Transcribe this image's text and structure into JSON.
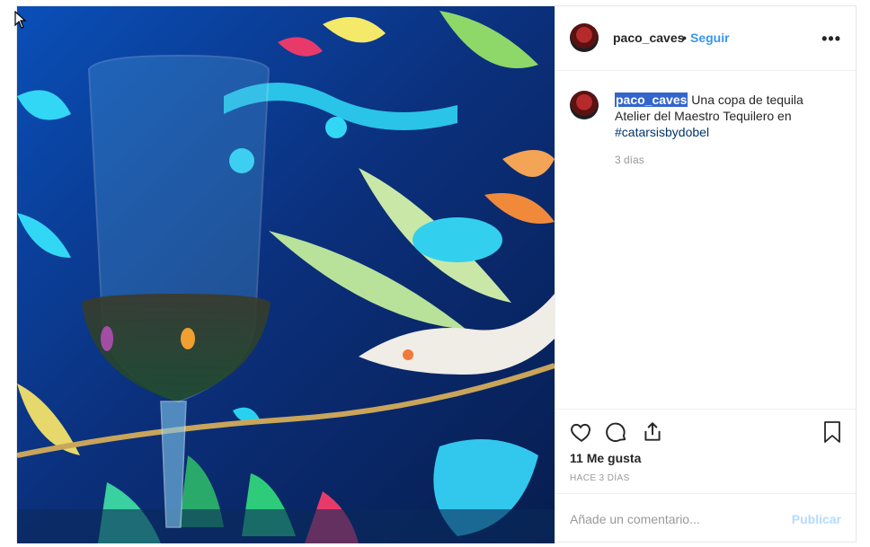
{
  "post": {
    "username": "paco_caves",
    "separator": "•",
    "follow_label": "Seguir",
    "more_label": "•••",
    "caption_user": "paco_caves",
    "caption_text": " Una copa de tequila Atelier del Maestro Tequilero en ",
    "caption_hashtag": "#catarsisbydobel",
    "caption_time": "3 días",
    "likes": "11 Me gusta",
    "post_time": "HACE 3 DÍAS",
    "comment_placeholder": "Añade un comentario...",
    "publish_label": "Publicar"
  },
  "icons": {
    "like": "heart-icon",
    "comment": "comment-icon",
    "share": "share-icon",
    "save": "bookmark-icon",
    "more": "more-options-icon"
  },
  "colors": {
    "link_blue": "#3897f0",
    "hashtag": "#003569",
    "publish_disabled": "#b3dbff",
    "muted": "#999999"
  }
}
